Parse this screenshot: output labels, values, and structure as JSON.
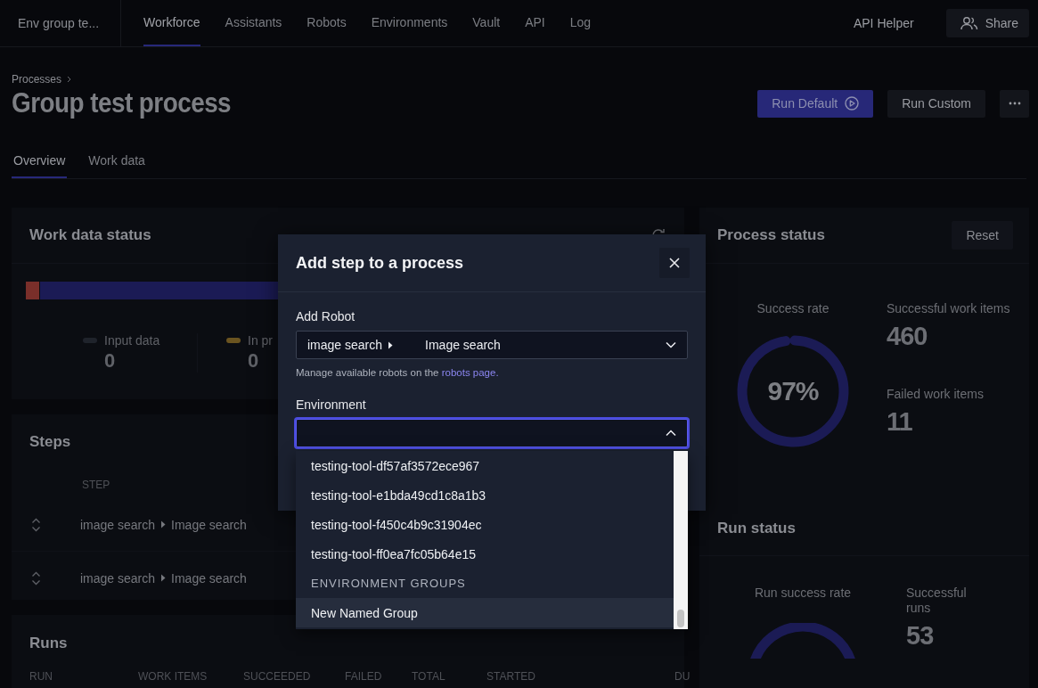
{
  "header": {
    "workspace": "Env group te...",
    "nav": [
      {
        "label": "Workforce",
        "selected": true
      },
      {
        "label": "Assistants",
        "selected": false
      },
      {
        "label": "Robots",
        "selected": false
      },
      {
        "label": "Environments",
        "selected": false
      },
      {
        "label": "Vault",
        "selected": false
      },
      {
        "label": "API",
        "selected": false
      },
      {
        "label": "Log",
        "selected": false
      }
    ],
    "api_helper": "API Helper",
    "share": "Share"
  },
  "breadcrumb": [
    "Processes"
  ],
  "title": "Group test process",
  "actions": {
    "run_default": "Run Default",
    "run_custom": "Run Custom"
  },
  "tabs": [
    {
      "label": "Overview",
      "selected": true
    },
    {
      "label": "Work data",
      "selected": false
    }
  ],
  "work_data_status": {
    "title": "Work data status",
    "legend": [
      {
        "label": "Input data",
        "value": "0",
        "color": "#1f232b"
      },
      {
        "label": "In pr",
        "value": "0",
        "color": "#6b5420"
      }
    ]
  },
  "steps": {
    "title": "Steps",
    "column": "STEP",
    "rows": [
      {
        "robot": "image search",
        "task": "Image search"
      },
      {
        "robot": "image search",
        "task": "Image search"
      }
    ]
  },
  "runs": {
    "title": "Runs",
    "columns": [
      "RUN",
      "WORK ITEMS",
      "SUCCEEDED",
      "FAILED",
      "TOTAL",
      "STARTED",
      "DU"
    ]
  },
  "process_status": {
    "title": "Process status",
    "reset": "Reset",
    "success_rate": {
      "label": "Success rate",
      "value": "97%",
      "level": 0.97
    },
    "stats": [
      {
        "label": "Successful work items",
        "value": "460"
      },
      {
        "label": "Failed work items",
        "value": "11"
      }
    ]
  },
  "run_status": {
    "title": "Run status",
    "success_rate": {
      "label": "Run success rate"
    },
    "stats": [
      {
        "label": "Successful runs",
        "value": "53"
      }
    ]
  },
  "modal": {
    "title": "Add step to a process",
    "robot_label": "Add Robot",
    "robot": {
      "robot": "image search",
      "task": "Image search"
    },
    "help": "Manage available robots on the ",
    "help_link": "robots page.",
    "environment_label": "Environment",
    "options": [
      {
        "kind": "option",
        "label": "testing-tool-df57af3572ece967",
        "highlighted": false
      },
      {
        "kind": "option",
        "label": "testing-tool-e1bda49cd1c8a1b3",
        "highlighted": false
      },
      {
        "kind": "option",
        "label": "testing-tool-f450c4b9c31904ec",
        "highlighted": false
      },
      {
        "kind": "option",
        "label": "testing-tool-ff0ea7fc05b64e15",
        "highlighted": false
      },
      {
        "kind": "group",
        "label": "ENVIRONMENT GROUPS",
        "highlighted": false
      },
      {
        "kind": "option",
        "label": "New Named Group",
        "highlighted": true
      }
    ]
  }
}
